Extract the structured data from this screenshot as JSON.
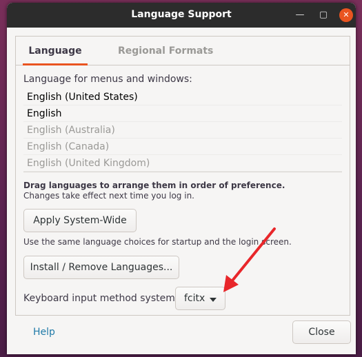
{
  "window": {
    "title": "Language Support",
    "controls": [
      "minimize-icon",
      "maximize-icon",
      "close-icon"
    ]
  },
  "tabs": [
    {
      "label": "Language",
      "active": true
    },
    {
      "label": "Regional Formats",
      "active": false
    }
  ],
  "language": {
    "label": "Language for menus and windows:",
    "items": [
      {
        "label": "English (United States)",
        "enabled": true
      },
      {
        "label": "English",
        "enabled": true
      },
      {
        "label": "English (Australia)",
        "enabled": false
      },
      {
        "label": "English (Canada)",
        "enabled": false
      },
      {
        "label": "English (United Kingdom)",
        "enabled": false
      }
    ],
    "drag_hint": "Drag languages to arrange them in order of preference.",
    "change_hint": "Changes take effect next time you log in."
  },
  "apply_button": "Apply System-Wide",
  "apply_hint": "Use the same language choices for startup and the login screen.",
  "install_button": "Install / Remove Languages...",
  "keyboard": {
    "label": "Keyboard input method system:",
    "value": "fcitx"
  },
  "footer": {
    "help": "Help",
    "close": "Close"
  },
  "colors": {
    "accent": "#e95420",
    "annotation_arrow": "#e8262a",
    "link": "#1f7aa8"
  }
}
